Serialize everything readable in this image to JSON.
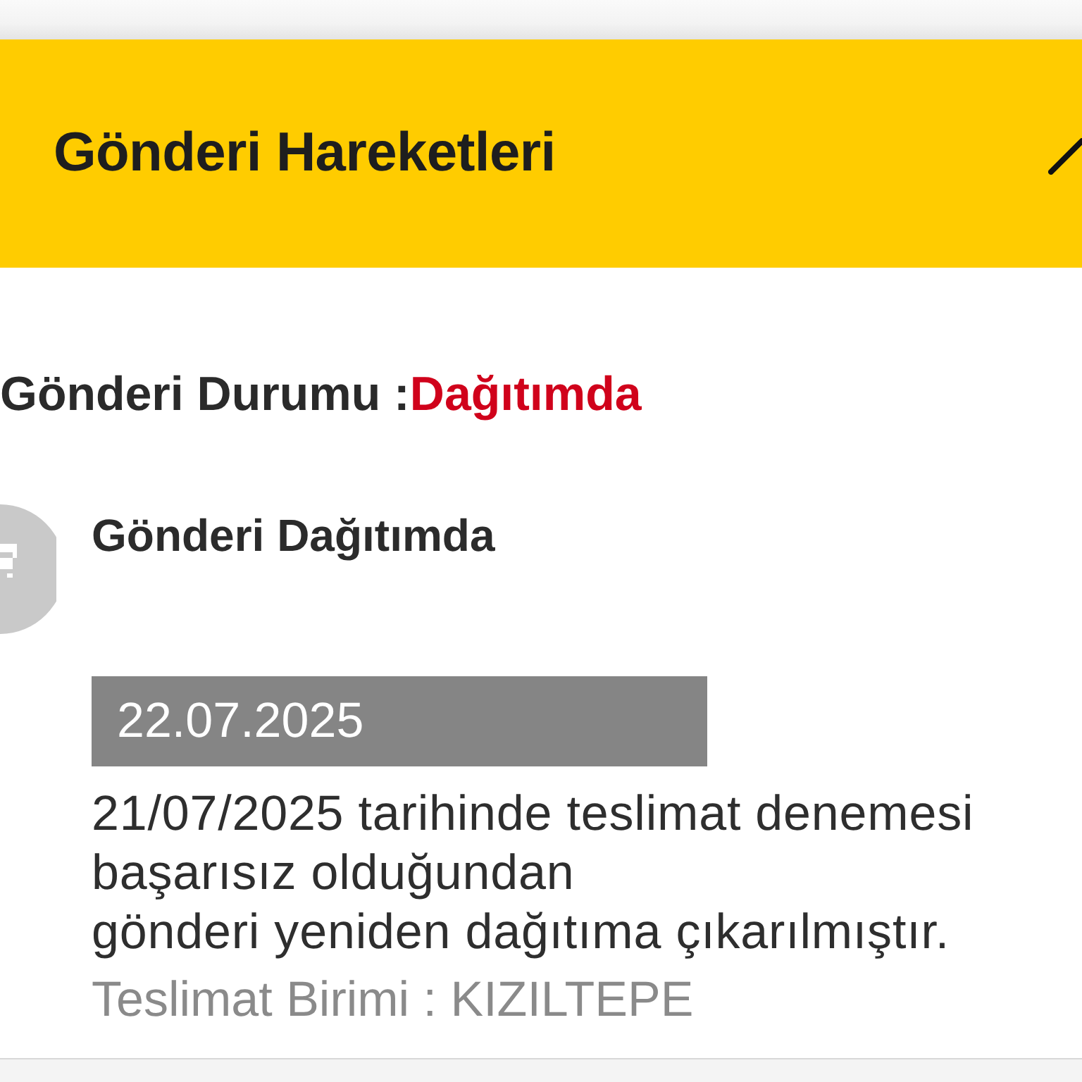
{
  "header": {
    "title": "Gönderi Hareketleri"
  },
  "status": {
    "label": "Gönderi Durumu :",
    "value": "Dağıtımda"
  },
  "events": [
    {
      "title": "Gönderi Dağıtımda",
      "date": "22.07.2025",
      "description": "21/07/2025 tarihinde teslimat denemesi\nbaşarısız olduğundan\ngönderi yeniden dağıtıma çıkarılmıştır.",
      "unit": "Teslimat Birimi : KIZILTEPE"
    }
  ]
}
